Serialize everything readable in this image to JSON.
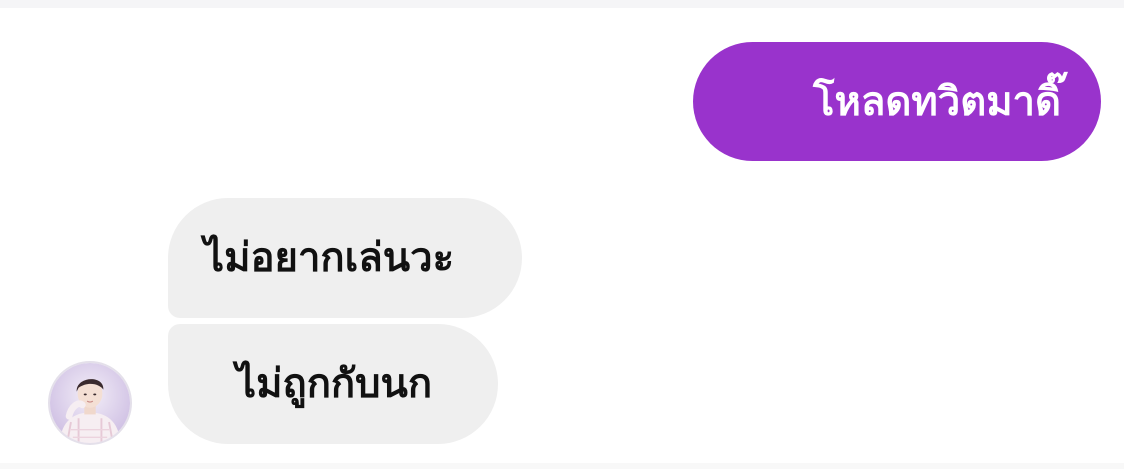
{
  "conversation": {
    "messages": [
      {
        "direction": "outgoing",
        "text": "โหลดทวิตมาดิ๊"
      },
      {
        "direction": "incoming",
        "text": "ไม่อยากเล่นวะ"
      },
      {
        "direction": "incoming",
        "text": "ไม่ถูกกับนก"
      }
    ]
  },
  "colors": {
    "outgoing_bubble": "#9933cc",
    "incoming_bubble": "#efefef",
    "incoming_text": "#111111",
    "outgoing_text": "#ffffff"
  },
  "icons": {
    "avatar": "contact-avatar"
  }
}
